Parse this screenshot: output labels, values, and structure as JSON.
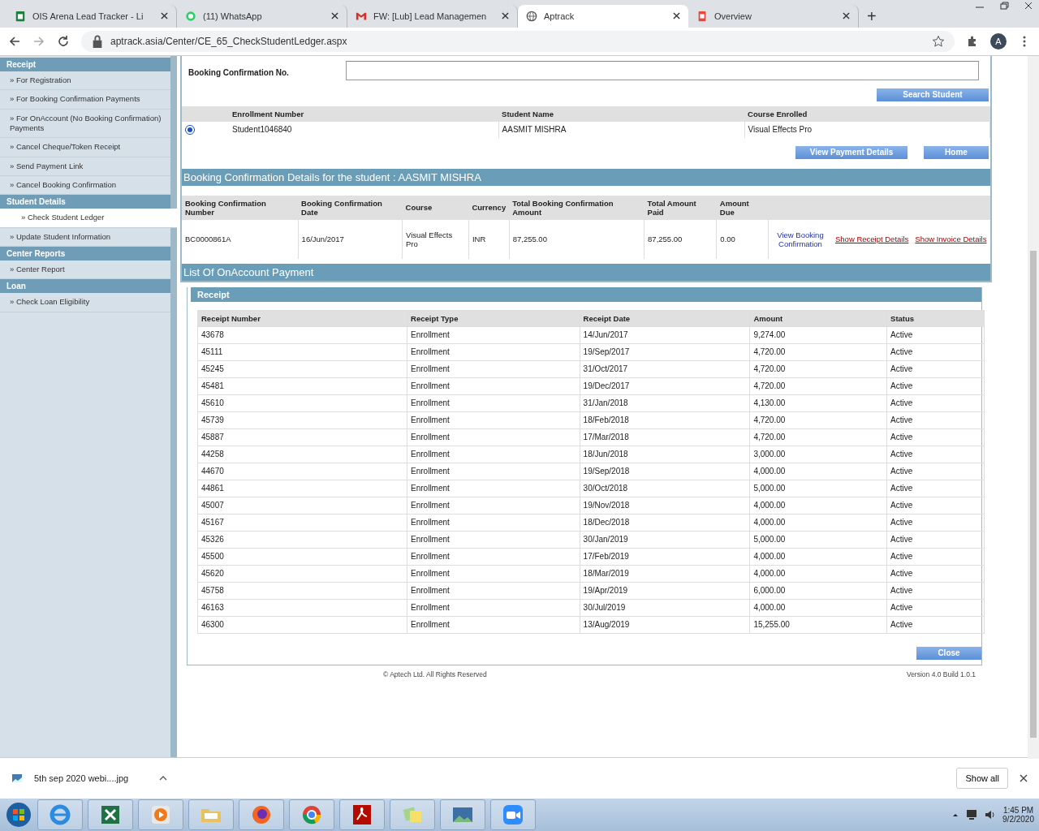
{
  "browser": {
    "tabs": [
      {
        "title": "OIS Arena Lead Tracker - Li",
        "kind": "sheet",
        "selected": false
      },
      {
        "title": "(11) WhatsApp",
        "kind": "chat",
        "selected": false
      },
      {
        "title": "FW: [Lub] Lead Managemen",
        "kind": "mail",
        "selected": false
      },
      {
        "title": "Aptrack",
        "kind": "globe",
        "selected": true
      },
      {
        "title": "Overview",
        "kind": "doc",
        "selected": false
      }
    ],
    "new_tab": "+",
    "url": "aptrack.asia/Center/CE_65_CheckStudentLedger.aspx",
    "profile": "A"
  },
  "sidebar": {
    "sections": [
      {
        "title": "Receipt",
        "items": [
          {
            "label": "» For Registration",
            "selected": false
          },
          {
            "label": "» For Booking Confirmation Payments",
            "selected": false
          },
          {
            "label": "» For OnAccount (No Booking Confirmation) Payments",
            "selected": false
          },
          {
            "label": "» Cancel Cheque/Token Receipt",
            "selected": false
          },
          {
            "label": "» Send Payment Link",
            "selected": false
          },
          {
            "label": "» Cancel Booking Confirmation",
            "selected": false
          }
        ]
      },
      {
        "title": "Student Details",
        "items": [
          {
            "label": "» Check Student Ledger",
            "selected": true
          },
          {
            "label": "» Update Student Information",
            "selected": false
          }
        ]
      },
      {
        "title": "Center Reports",
        "items": [
          {
            "label": "» Center Report",
            "selected": false
          }
        ]
      },
      {
        "title": "Loan",
        "items": [
          {
            "label": "» Check Loan Eligibility",
            "selected": false
          }
        ]
      }
    ]
  },
  "search": {
    "label": "Booking Confirmation No.",
    "button": "Search Student"
  },
  "students": {
    "columns": [
      "Enrollment Number",
      "Student Name",
      "Course Enrolled"
    ],
    "rows": [
      {
        "selected": true,
        "cells": [
          "Student1046840",
          "AASMIT MISHRA",
          "Visual Effects Pro"
        ]
      }
    ],
    "buttons": [
      "View Payment Details",
      "Home"
    ]
  },
  "booking": {
    "title": "Booking Confirmation Details for the student : AASMIT MISHRA",
    "columns": [
      "Booking Confirmation Number",
      "Booking Confirmation Date",
      "Course",
      "Currency",
      "Total Booking Confirmation Amount",
      "Total Amount Paid",
      "Amount Due"
    ],
    "rows": [
      {
        "cells": [
          "BC0000861A",
          "16/Jun/2017",
          "Visual Effects Pro",
          "INR",
          "87,255.00",
          "87,255.00",
          "0.00"
        ],
        "links": [
          "View Booking Confirmation",
          "Show Receipt Details",
          "Show Invoice Details"
        ]
      }
    ]
  },
  "onaccount": {
    "title": "List Of OnAccount Payment",
    "panel_title": "Receipt",
    "columns": [
      "Receipt Number",
      "Receipt Type",
      "Receipt Date",
      "Amount",
      "Status"
    ],
    "rows": [
      [
        "43678",
        "Enrollment",
        "14/Jun/2017",
        "9,274.00",
        "Active"
      ],
      [
        "45111",
        "Enrollment",
        "19/Sep/2017",
        "4,720.00",
        "Active"
      ],
      [
        "45245",
        "Enrollment",
        "31/Oct/2017",
        "4,720.00",
        "Active"
      ],
      [
        "45481",
        "Enrollment",
        "19/Dec/2017",
        "4,720.00",
        "Active"
      ],
      [
        "45610",
        "Enrollment",
        "31/Jan/2018",
        "4,130.00",
        "Active"
      ],
      [
        "45739",
        "Enrollment",
        "18/Feb/2018",
        "4,720.00",
        "Active"
      ],
      [
        "45887",
        "Enrollment",
        "17/Mar/2018",
        "4,720.00",
        "Active"
      ],
      [
        "44258",
        "Enrollment",
        "18/Jun/2018",
        "3,000.00",
        "Active"
      ],
      [
        "44670",
        "Enrollment",
        "19/Sep/2018",
        "4,000.00",
        "Active"
      ],
      [
        "44861",
        "Enrollment",
        "30/Oct/2018",
        "5,000.00",
        "Active"
      ],
      [
        "45007",
        "Enrollment",
        "19/Nov/2018",
        "4,000.00",
        "Active"
      ],
      [
        "45167",
        "Enrollment",
        "18/Dec/2018",
        "4,000.00",
        "Active"
      ],
      [
        "45326",
        "Enrollment",
        "30/Jan/2019",
        "5,000.00",
        "Active"
      ],
      [
        "45500",
        "Enrollment",
        "17/Feb/2019",
        "4,000.00",
        "Active"
      ],
      [
        "45620",
        "Enrollment",
        "18/Mar/2019",
        "4,000.00",
        "Active"
      ],
      [
        "45758",
        "Enrollment",
        "19/Apr/2019",
        "6,000.00",
        "Active"
      ],
      [
        "46163",
        "Enrollment",
        "30/Jul/2019",
        "4,000.00",
        "Active"
      ],
      [
        "46300",
        "Enrollment",
        "13/Aug/2019",
        "15,255.00",
        "Active"
      ]
    ],
    "button": "Close"
  },
  "footer": {
    "copyright": "© Aptech Ltd. All Rights Reserved",
    "version": "Version 4.0 Build 1.0.1"
  },
  "download_bar": {
    "file": "5th sep 2020 webi....jpg",
    "show_all": "Show all"
  },
  "taskbar": {
    "apps": [
      {
        "kind": "ie"
      },
      {
        "kind": "excel"
      },
      {
        "kind": "media"
      },
      {
        "kind": "folder"
      },
      {
        "kind": "firefox"
      },
      {
        "kind": "chrome"
      },
      {
        "kind": "pdf"
      },
      {
        "kind": "notes"
      },
      {
        "kind": "photos"
      },
      {
        "kind": "video"
      }
    ],
    "time": "1:45 PM",
    "date": "9/2/2020"
  }
}
